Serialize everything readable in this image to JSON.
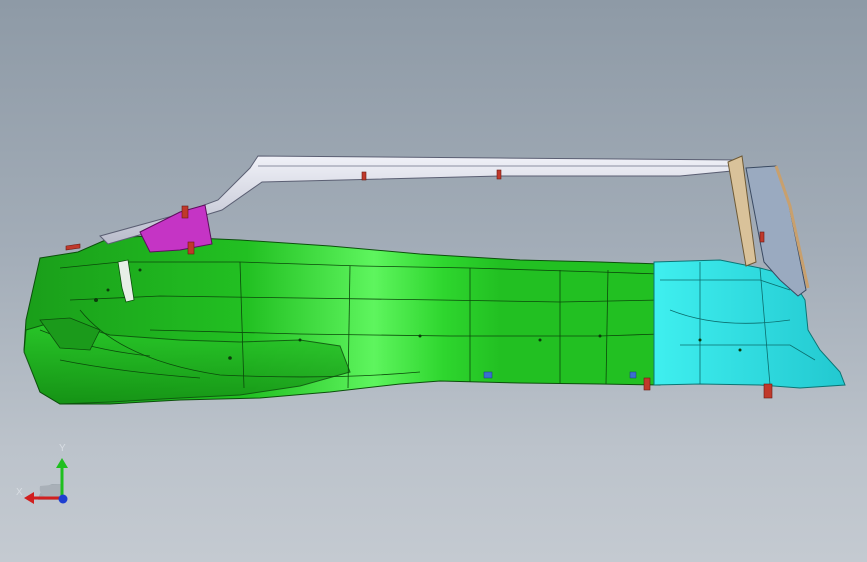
{
  "viewport": {
    "background_top": "#8e9aa6",
    "background_bottom": "#c4cad1"
  },
  "model": {
    "body_color": "#22bf22",
    "body_highlight": "#5cf25c",
    "rear_color": "#33e6e6",
    "frame_color": "#d9dce8",
    "bracket_color": "#c534c5",
    "pillar_color": "#d9c29a",
    "pin_color": "#c0392b"
  },
  "triad": {
    "y_label": "Y",
    "x_label": "X",
    "y_color": "#1fbf1f",
    "x_color": "#d11f1f",
    "z_color": "#1f3fd1"
  }
}
